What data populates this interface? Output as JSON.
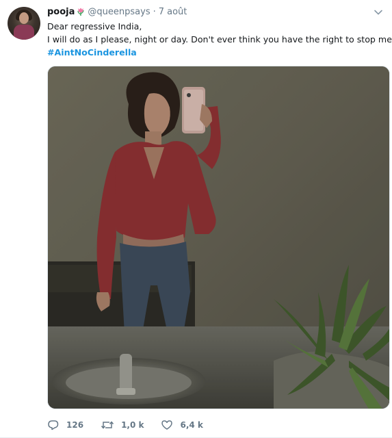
{
  "tweet": {
    "author": {
      "name": "pooja",
      "handle": "@queenpsays",
      "separator": "·",
      "date": "7 août",
      "avatar_icon": "profile-avatar",
      "name_emoji_icon": "tulip-icon"
    },
    "text_lines": [
      "Dear regressive India,",
      "I will do as I please, night or day. Don't ever think you have the right to stop me"
    ],
    "hashtag": "#AintNoCinderella",
    "media": {
      "kind": "photo"
    },
    "actions": {
      "reply_count": "126",
      "retweet_count": "1,0 k",
      "like_count": "6,4 k"
    }
  },
  "colors": {
    "link": "#1b95e0",
    "muted": "#657786",
    "text": "#14171a"
  }
}
